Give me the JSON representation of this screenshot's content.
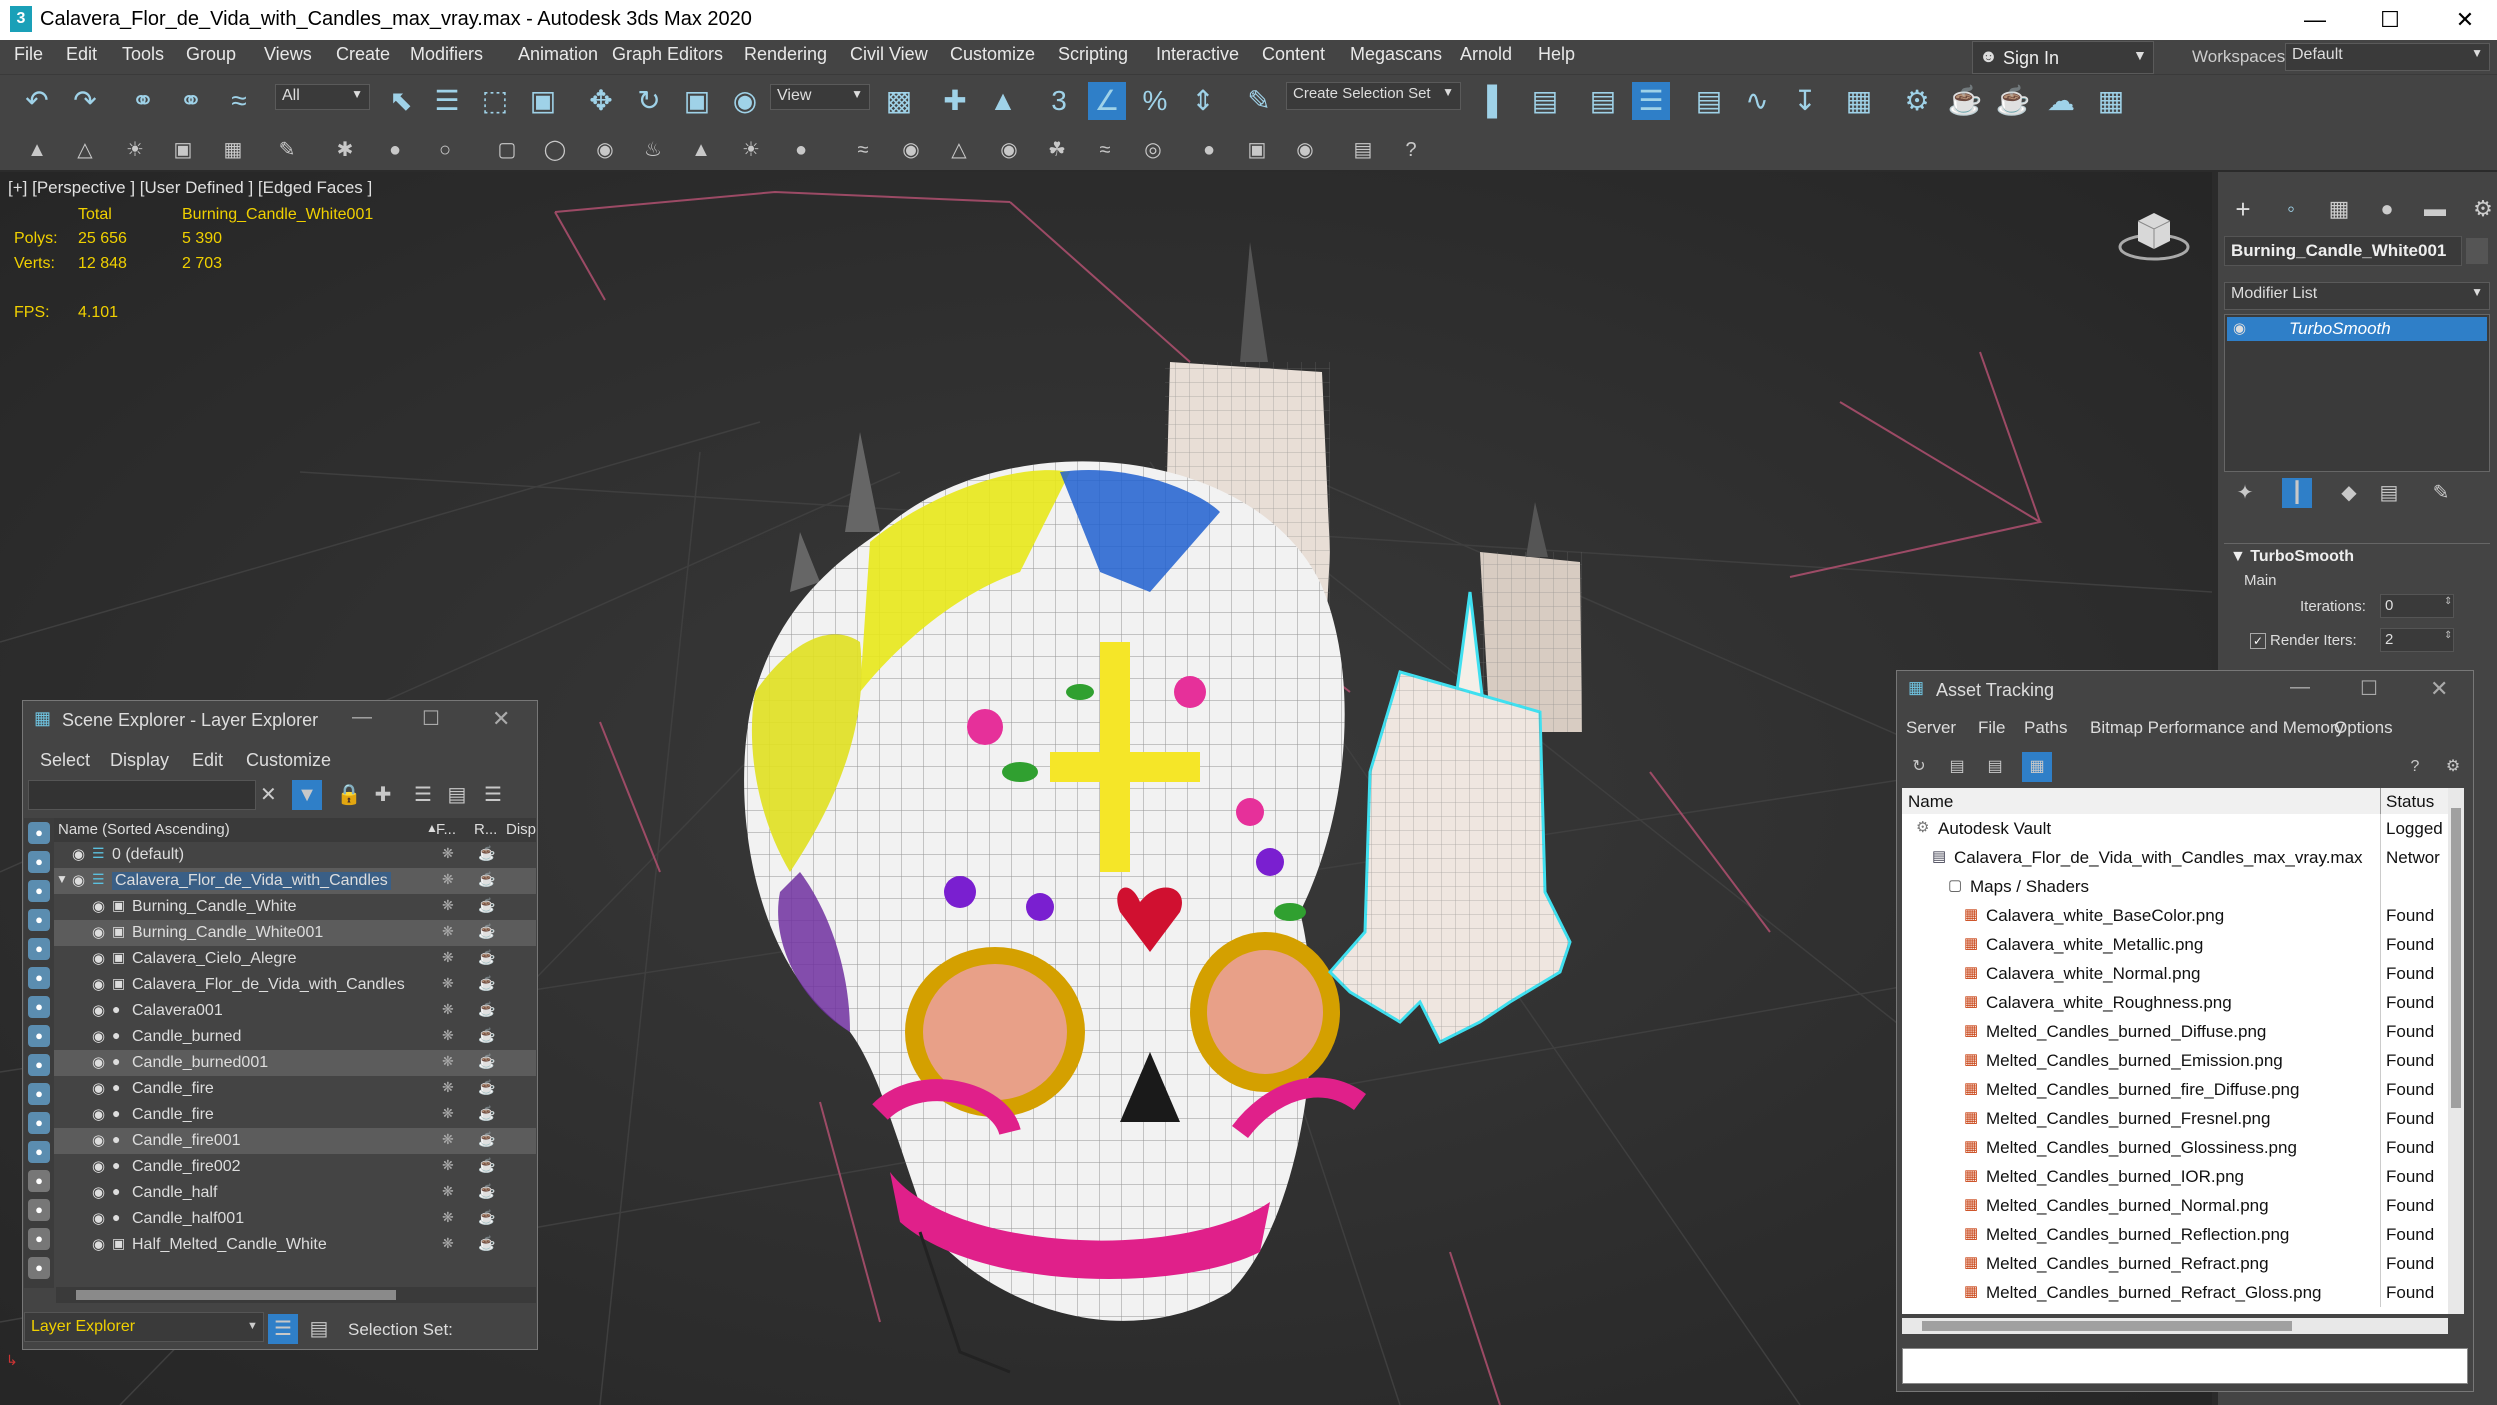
{
  "window": {
    "title": "Calavera_Flor_de_Vida_with_Candles_max_vray.max - Autodesk 3ds Max 2020",
    "app_icon": "3",
    "controls": [
      "minimize-icon",
      "maximize-icon",
      "close-icon"
    ]
  },
  "menu": [
    "File",
    "Edit",
    "Tools",
    "Group",
    "Views",
    "Create",
    "Modifiers",
    "Animation",
    "Graph Editors",
    "Rendering",
    "Civil View",
    "Customize",
    "Scripting",
    "Interactive",
    "Content",
    "Megascans",
    "Arnold",
    "Help"
  ],
  "account": {
    "sign_in": "Sign In",
    "workspaces_label": "Workspaces:",
    "workspace_value": "Default"
  },
  "toolbar": {
    "filter_value": "All",
    "ref_coord_value": "View",
    "selection_set_placeholder": "Create Selection Set"
  },
  "viewport": {
    "label": "[+] [Perspective ] [User Defined ] [Edged Faces ]",
    "stats": {
      "total_label": "Total",
      "object_label": "Burning_Candle_White001",
      "polys_label": "Polys:",
      "polys_total": "25 656",
      "polys_obj": "5 390",
      "verts_label": "Verts:",
      "verts_total": "12 848",
      "verts_obj": "2 703",
      "fps_label": "FPS:",
      "fps_value": "4.101"
    }
  },
  "command_panel": {
    "object_name": "Burning_Candle_White001",
    "modifier_list_label": "Modifier List",
    "modifier": "TurboSmooth",
    "rollout_title": "TurboSmooth",
    "group_main": "Main",
    "iterations_label": "Iterations:",
    "iterations_value": "0",
    "render_iters_label": "Render Iters:",
    "render_iters_value": "2"
  },
  "scene_explorer": {
    "title": "Scene Explorer - Layer Explorer",
    "menu": [
      "Select",
      "Display",
      "Edit",
      "Customize"
    ],
    "col_name": "Name (Sorted Ascending)",
    "col_f": "F...",
    "col_r": "R...",
    "col_disp": "Disp",
    "rows": [
      {
        "name": "0 (default)",
        "level": 0,
        "selected": false
      },
      {
        "name": "Calavera_Flor_de_Vida_with_Candles",
        "level": 0,
        "selected": true
      },
      {
        "name": "Burning_Candle_White",
        "level": 1,
        "selected": false
      },
      {
        "name": "Burning_Candle_White001",
        "level": 1,
        "selected": true
      },
      {
        "name": "Calavera_Cielo_Alegre",
        "level": 1,
        "selected": false
      },
      {
        "name": "Calavera_Flor_de_Vida_with_Candles",
        "level": 1,
        "selected": false
      },
      {
        "name": "Calavera001",
        "level": 1,
        "selected": false
      },
      {
        "name": "Candle_burned",
        "level": 1,
        "selected": false
      },
      {
        "name": "Candle_burned001",
        "level": 1,
        "selected": true
      },
      {
        "name": "Candle_fire",
        "level": 1,
        "selected": false
      },
      {
        "name": "Candle_fire",
        "level": 1,
        "selected": false
      },
      {
        "name": "Candle_fire001",
        "level": 1,
        "selected": true
      },
      {
        "name": "Candle_fire002",
        "level": 1,
        "selected": false
      },
      {
        "name": "Candle_half",
        "level": 1,
        "selected": false
      },
      {
        "name": "Candle_half001",
        "level": 1,
        "selected": false
      },
      {
        "name": "Half_Melted_Candle_White",
        "level": 1,
        "selected": false
      }
    ],
    "footer_label": "Layer Explorer",
    "selection_set_label": "Selection Set:"
  },
  "asset_tracking": {
    "title": "Asset Tracking",
    "menu": [
      "Server",
      "File",
      "Paths",
      "Bitmap Performance and Memory",
      "Options"
    ],
    "col_name": "Name",
    "col_status": "Status",
    "rows": [
      {
        "name": "Autodesk Vault",
        "status": "Logged",
        "level": 0
      },
      {
        "name": "Calavera_Flor_de_Vida_with_Candles_max_vray.max",
        "status": "Networ",
        "level": 1
      },
      {
        "name": "Maps / Shaders",
        "status": "",
        "level": 2
      },
      {
        "name": "Calavera_white_BaseColor.png",
        "status": "Found",
        "level": 3
      },
      {
        "name": "Calavera_white_Metallic.png",
        "status": "Found",
        "level": 3
      },
      {
        "name": "Calavera_white_Normal.png",
        "status": "Found",
        "level": 3
      },
      {
        "name": "Calavera_white_Roughness.png",
        "status": "Found",
        "level": 3
      },
      {
        "name": "Melted_Candles_burned_Diffuse.png",
        "status": "Found",
        "level": 3
      },
      {
        "name": "Melted_Candles_burned_Emission.png",
        "status": "Found",
        "level": 3
      },
      {
        "name": "Melted_Candles_burned_fire_Diffuse.png",
        "status": "Found",
        "level": 3
      },
      {
        "name": "Melted_Candles_burned_Fresnel.png",
        "status": "Found",
        "level": 3
      },
      {
        "name": "Melted_Candles_burned_Glossiness.png",
        "status": "Found",
        "level": 3
      },
      {
        "name": "Melted_Candles_burned_IOR.png",
        "status": "Found",
        "level": 3
      },
      {
        "name": "Melted_Candles_burned_Normal.png",
        "status": "Found",
        "level": 3
      },
      {
        "name": "Melted_Candles_burned_Reflection.png",
        "status": "Found",
        "level": 3
      },
      {
        "name": "Melted_Candles_burned_Refract.png",
        "status": "Found",
        "level": 3
      },
      {
        "name": "Melted_Candles_burned_Refract_Gloss.png",
        "status": "Found",
        "level": 3
      }
    ]
  },
  "colors": {
    "accent": "#2f7fc8",
    "selection_outline": "#3fe0f0",
    "stats_yellow": "#f0d000",
    "bg_dark": "#2e2e2e",
    "panel": "#444444"
  }
}
